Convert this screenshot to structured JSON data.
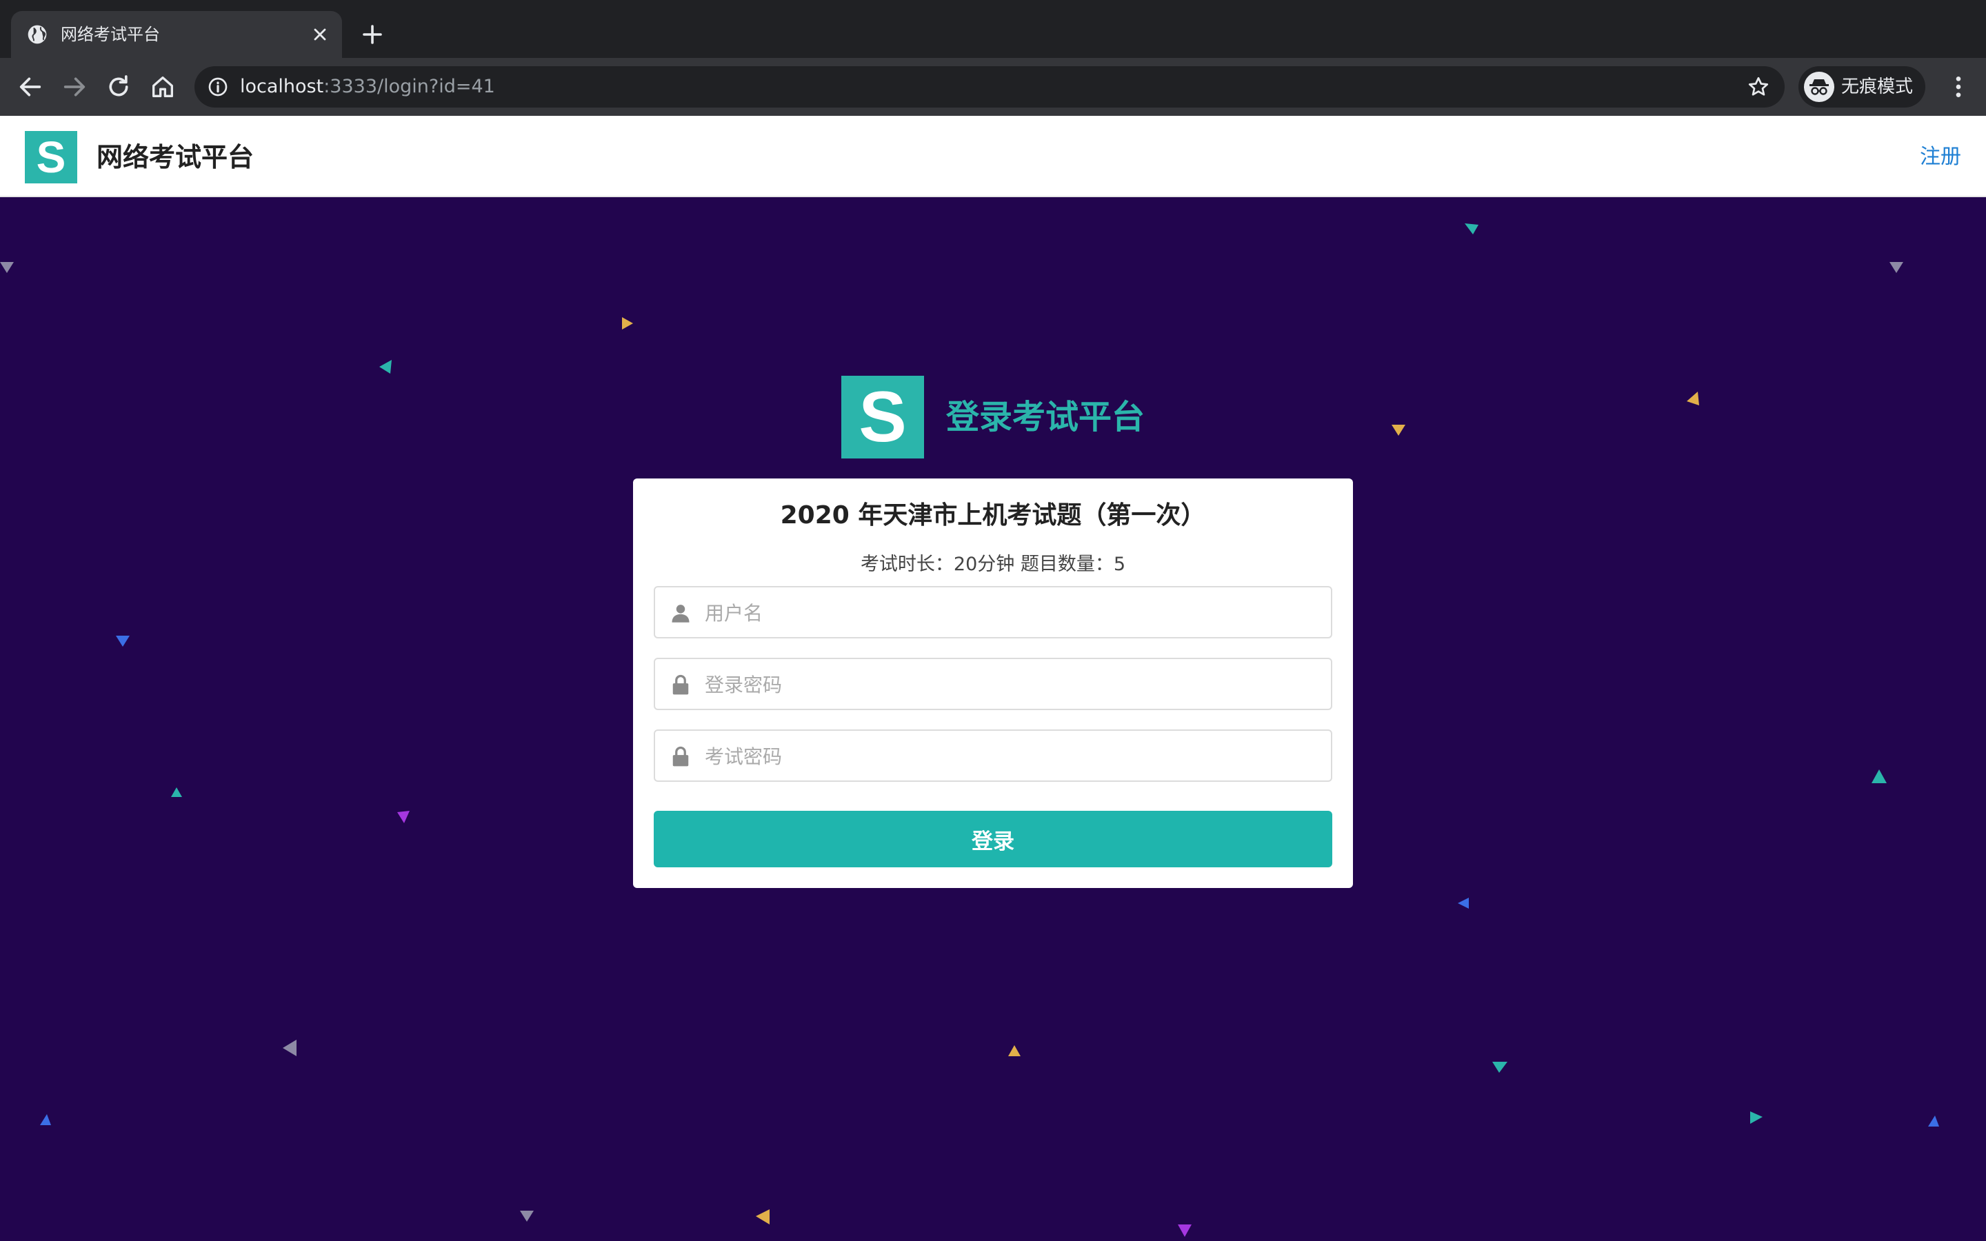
{
  "browser": {
    "tab_title": "网络考试平台",
    "url_host": "localhost",
    "url_rest": ":3333/login?id=41",
    "incognito_label": "无痕模式"
  },
  "site": {
    "logo_letter": "S",
    "name": "网络考试平台",
    "register_link": "注册"
  },
  "brand": {
    "logo_letter": "S",
    "heading": "登录考试平台"
  },
  "exam": {
    "title": "2020 年天津市上机考试题（第一次）",
    "meta": "考试时长：20分钟   题目数量：5"
  },
  "form": {
    "username_placeholder": "用户名",
    "password_placeholder": "登录密码",
    "exam_password_placeholder": "考试密码",
    "submit_label": "登录"
  },
  "colors": {
    "background": "#22054e",
    "accent": "#2bb5ab",
    "link": "#1e7fd3",
    "triangle_teal": "#2bb5ab",
    "triangle_gold": "#e2b04a",
    "triangle_blue": "#3b6fe6",
    "triangle_purple": "#a537e0",
    "triangle_gray": "#8d8aa5"
  }
}
